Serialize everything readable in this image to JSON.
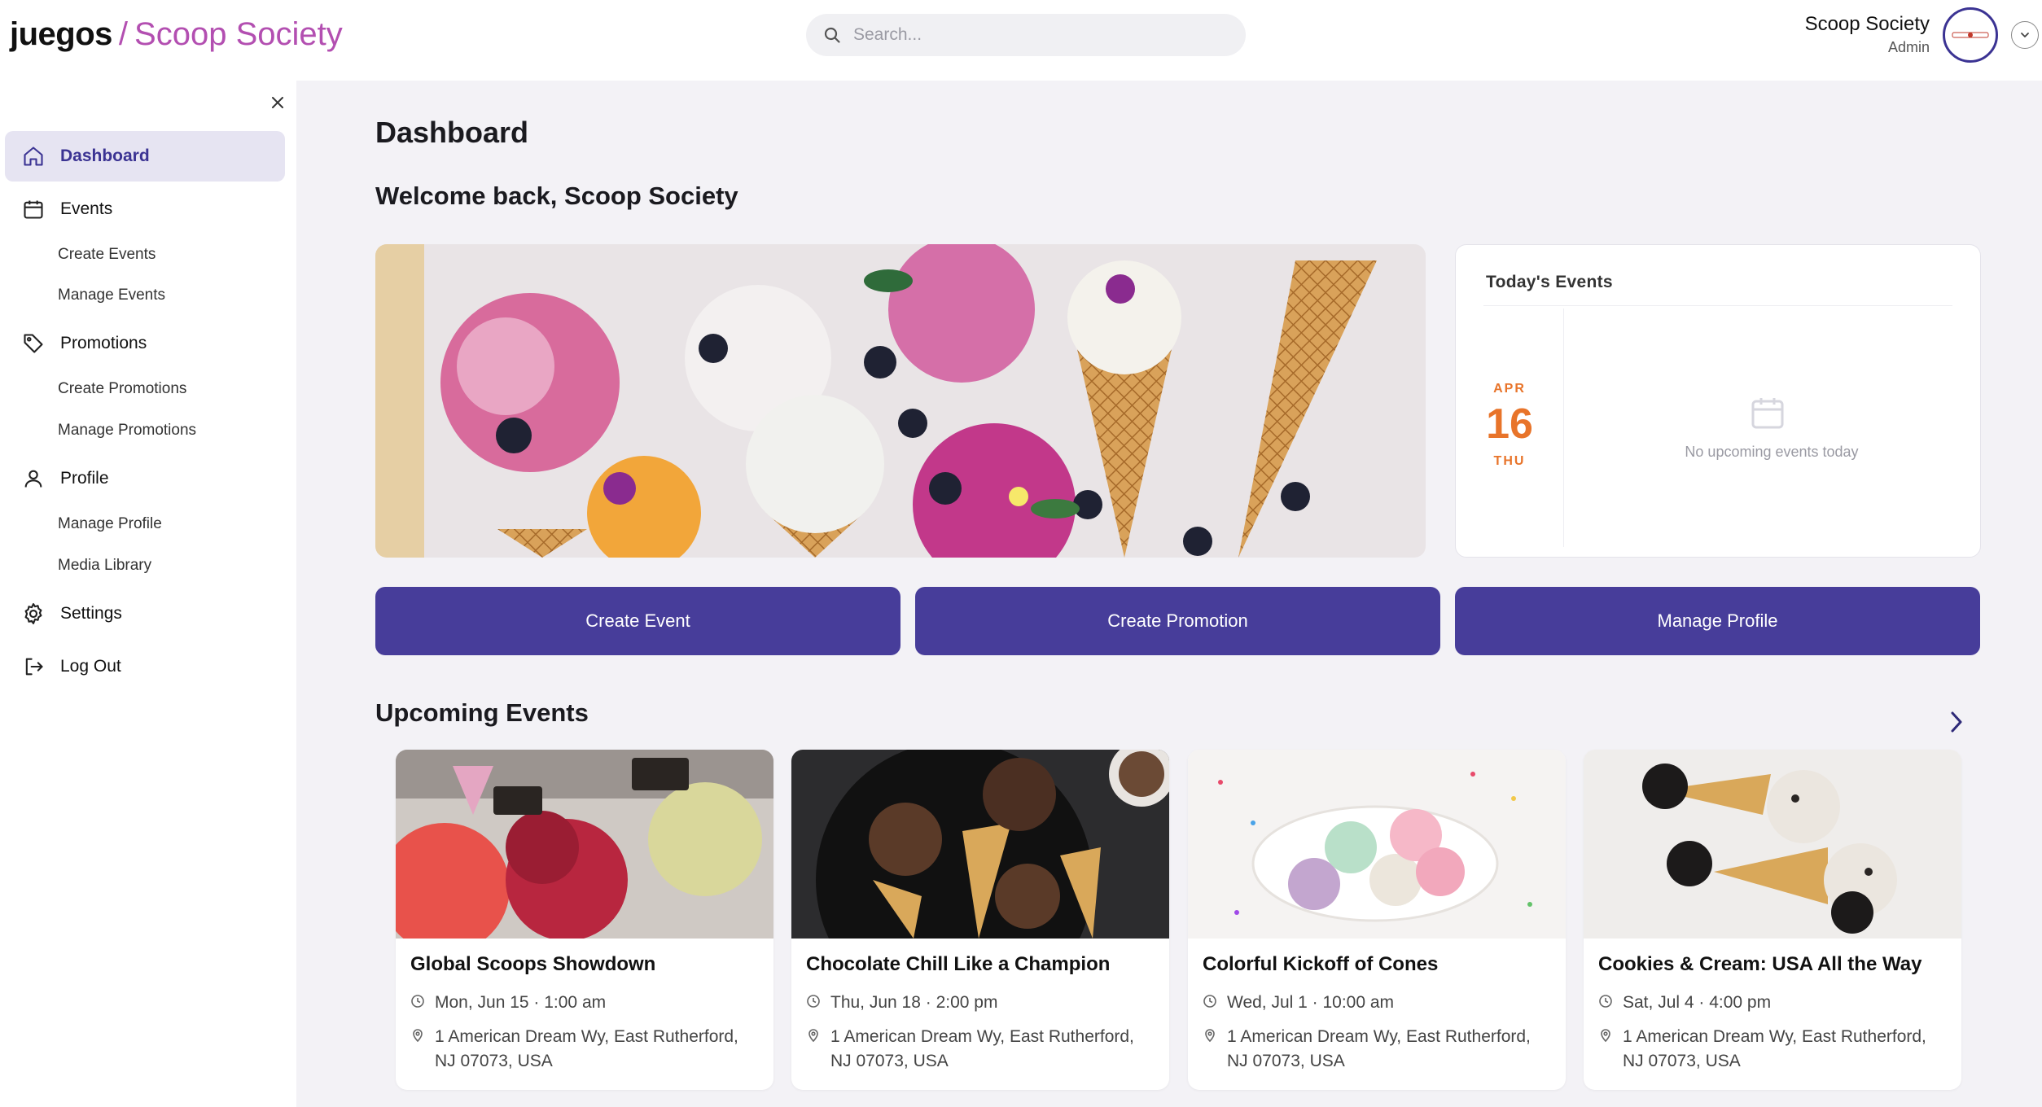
{
  "header": {
    "brand": "juegos",
    "separator": "/",
    "org": "Scoop Society",
    "search_placeholder": "Search...",
    "user_name": "Scoop Society",
    "user_role": "Admin"
  },
  "sidebar": {
    "items": [
      {
        "label": "Dashboard",
        "icon": "home-icon",
        "active": true
      },
      {
        "label": "Events",
        "icon": "calendar-icon"
      },
      {
        "label": "Create Events",
        "sub": true
      },
      {
        "label": "Manage Events",
        "sub": true
      },
      {
        "label": "Promotions",
        "icon": "tag-icon"
      },
      {
        "label": "Create Promotions",
        "sub": true
      },
      {
        "label": "Manage Promotions",
        "sub": true
      },
      {
        "label": "Profile",
        "icon": "user-icon"
      },
      {
        "label": "Manage Profile",
        "sub": true
      },
      {
        "label": "Media Library",
        "sub": true
      },
      {
        "label": "Settings",
        "icon": "gear-icon"
      },
      {
        "label": "Log Out",
        "icon": "logout-icon"
      }
    ]
  },
  "main": {
    "title": "Dashboard",
    "welcome": "Welcome back, Scoop Society",
    "today": {
      "title": "Today's Events",
      "month": "APR",
      "day": "16",
      "weekday": "THU",
      "empty": "No upcoming events today"
    },
    "actions": [
      "Create Event",
      "Create Promotion",
      "Manage Profile"
    ],
    "upcoming_title": "Upcoming Events",
    "events": [
      {
        "title": "Global Scoops Showdown",
        "when": "Mon, Jun 15 · 1:00 am",
        "where": "1 American Dream Wy, East Rutherford, NJ 07073, USA"
      },
      {
        "title": "Chocolate Chill Like a Champion",
        "when": "Thu, Jun 18 · 2:00 pm",
        "where": "1 American Dream Wy, East Rutherford, NJ 07073, USA"
      },
      {
        "title": "Colorful Kickoff of Cones",
        "when": "Wed, Jul 1 · 10:00 am",
        "where": "1 American Dream Wy, East Rutherford, NJ 07073, USA"
      },
      {
        "title": "Cookies & Cream: USA All the Way",
        "when": "Sat, Jul 4 · 4:00 pm",
        "where": "1 American Dream Wy, East Rutherford, NJ 07073, USA"
      }
    ]
  },
  "colors": {
    "accent": "#473d9a",
    "brand_pink": "#b34fb1",
    "date_orange": "#e8742a",
    "active_bg": "#e6e4f2"
  }
}
